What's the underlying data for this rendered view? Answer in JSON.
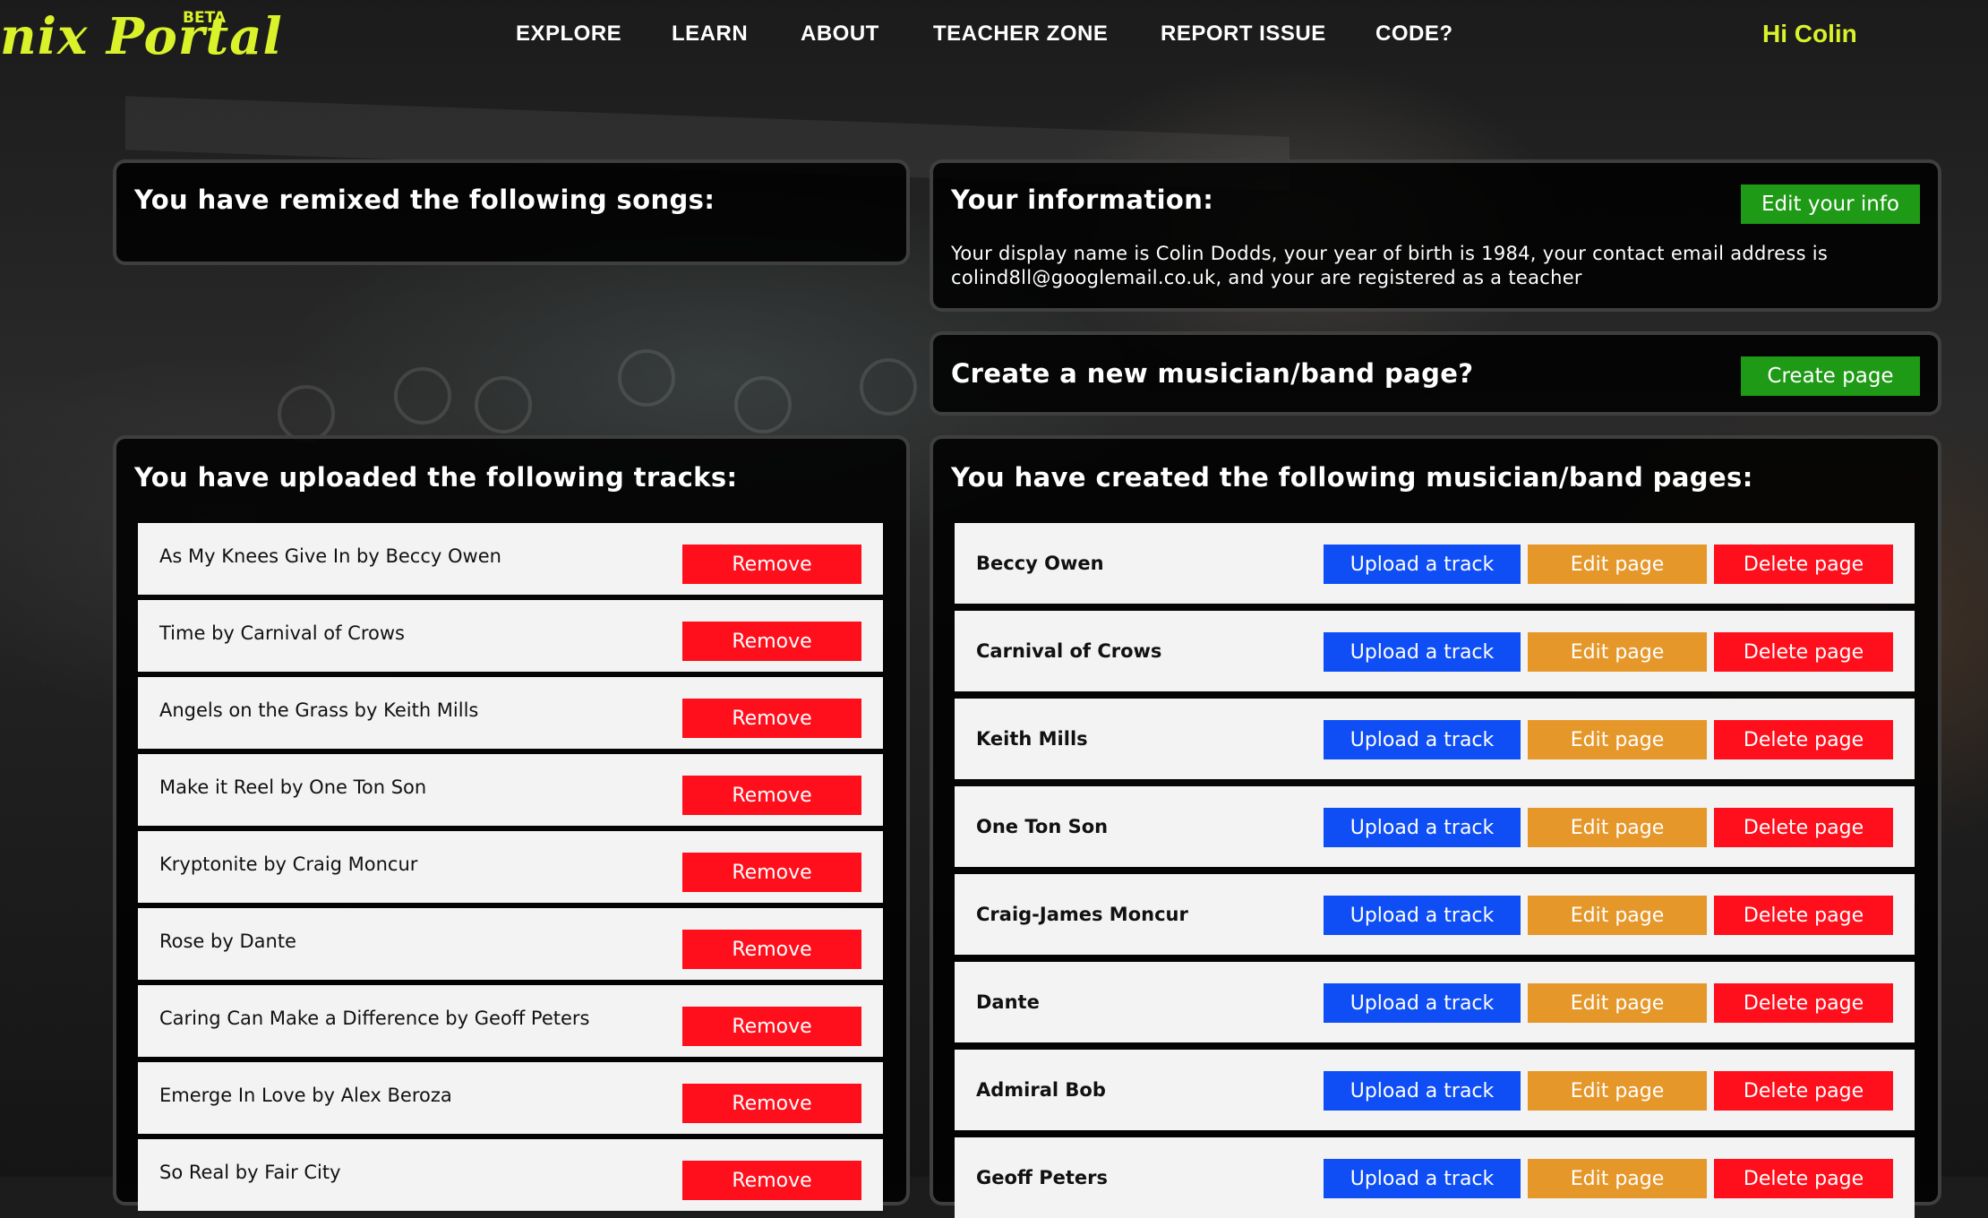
{
  "header": {
    "brand": "nix Portal",
    "beta": "BETA",
    "nav": [
      "EXPLORE",
      "LEARN",
      "ABOUT",
      "TEACHER ZONE",
      "REPORT ISSUE",
      "CODE?"
    ],
    "greeting": "Hi Colin"
  },
  "remixed": {
    "title": "You have remixed the following songs:"
  },
  "info": {
    "title": "Your information:",
    "edit_label": "Edit your info",
    "text": "Your display name is Colin Dodds, your year of birth is 1984, your contact email address is colind8ll@googlemail.co.uk, and your are registered as a teacher"
  },
  "create": {
    "title": "Create a new musician/band page?",
    "button_label": "Create page"
  },
  "uploads": {
    "title": "You have uploaded the following tracks:",
    "remove_label": "Remove",
    "tracks": [
      "As My Knees Give In by Beccy Owen",
      "Time by Carnival of Crows",
      "Angels on the Grass by Keith Mills",
      "Make it Reel by One Ton Son",
      "Kryptonite by Craig Moncur",
      "Rose by Dante",
      "Caring Can Make a Difference by Geoff Peters",
      "Emerge In Love by Alex Beroza",
      "So Real by Fair City"
    ]
  },
  "bands": {
    "title": "You have created the following musician/band pages:",
    "upload_label": "Upload a track",
    "edit_label": "Edit page",
    "delete_label": "Delete page",
    "pages": [
      "Beccy Owen",
      "Carnival of Crows",
      "Keith Mills",
      "One Ton Son",
      "Craig-James Moncur",
      "Dante",
      "Admiral Bob",
      "Geoff Peters"
    ]
  },
  "colors": {
    "accent": "#d9f22a",
    "green": "#1e9a16",
    "red": "#ff0f1c",
    "blue": "#0f4ef5",
    "orange": "#e5972a"
  }
}
